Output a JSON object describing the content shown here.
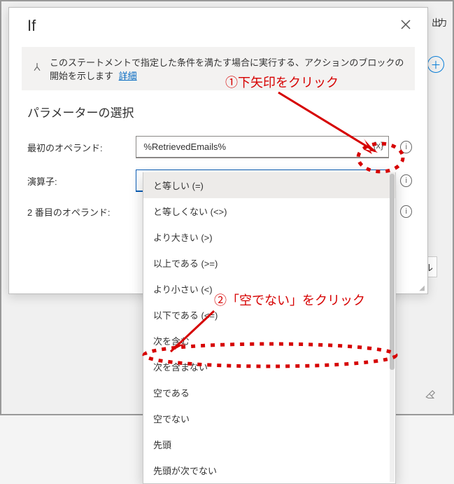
{
  "background": {
    "right_text": "出力",
    "cancel_label": "ンセル",
    "plus_icon": "＋",
    "eraser_icon": "eraser"
  },
  "dialog": {
    "title": "If",
    "banner": {
      "text": "このステートメントで指定した条件を満たす場合に実行する、アクションのブロックの開始を示します",
      "link": "詳細"
    },
    "section_title": "パラメーターの選択",
    "rows": {
      "first_operand": {
        "label": "最初のオペランド:",
        "value": "%RetrievedEmails%",
        "var_icon": "{x}"
      },
      "operator": {
        "label": "演算子:",
        "value": "と等しい (=)"
      },
      "second_operand": {
        "label": "2 番目のオペランド:"
      }
    }
  },
  "dropdown": {
    "items": [
      "と等しい (=)",
      "と等しくない (<>)",
      "より大きい (>)",
      "以上である (>=)",
      "より小さい (<)",
      "以下である (<=)",
      "次を含む",
      "次を含まない",
      "空である",
      "空でない",
      "先頭",
      "先頭が次でない"
    ]
  },
  "annotations": {
    "step1": "①下矢印をクリック",
    "step2": "②「空でない」をクリック"
  }
}
